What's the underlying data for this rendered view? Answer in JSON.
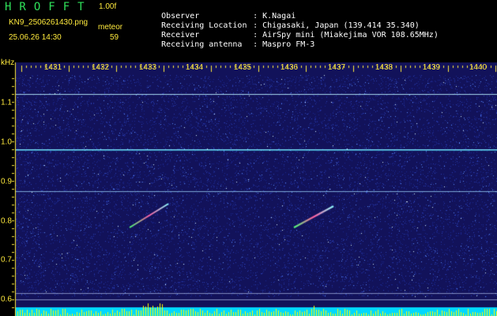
{
  "app": {
    "title": "HROFFT",
    "version": "1.00f",
    "filename": "KN9_2506261430.png",
    "timestamp": "25.06.26 14:30",
    "meteor_label": "meteor",
    "meteor_count": "59"
  },
  "info": [
    {
      "label": "Observer",
      "value": "K.Nagai"
    },
    {
      "label": "Receiving Location",
      "value": "Chigasaki, Japan (139.414 35.340)"
    },
    {
      "label": "Receiver",
      "value": "AirSpy mini (Miakejima VOR 108.65MHz)"
    },
    {
      "label": "Receiving antenna",
      "value": "Maspro FM-3"
    }
  ],
  "axis": {
    "unit": "kHz",
    "freq_ticks": [
      "1431",
      "1432",
      "1433",
      "1434",
      "1435",
      "1436",
      "1437",
      "1438",
      "1439",
      "1440"
    ],
    "y_ticks": [
      "1.1",
      "1.0",
      "0.9",
      "0.8",
      "0.7",
      "0.6"
    ]
  },
  "colors": {
    "background": "#000000",
    "spectrogram_bg": "#12125a",
    "label": "#ffea3d",
    "title": "#2fe05a",
    "carrier_line": "#7fe8ff",
    "bottom_band": "#00d8ff",
    "peaks": "#ffff00"
  }
}
